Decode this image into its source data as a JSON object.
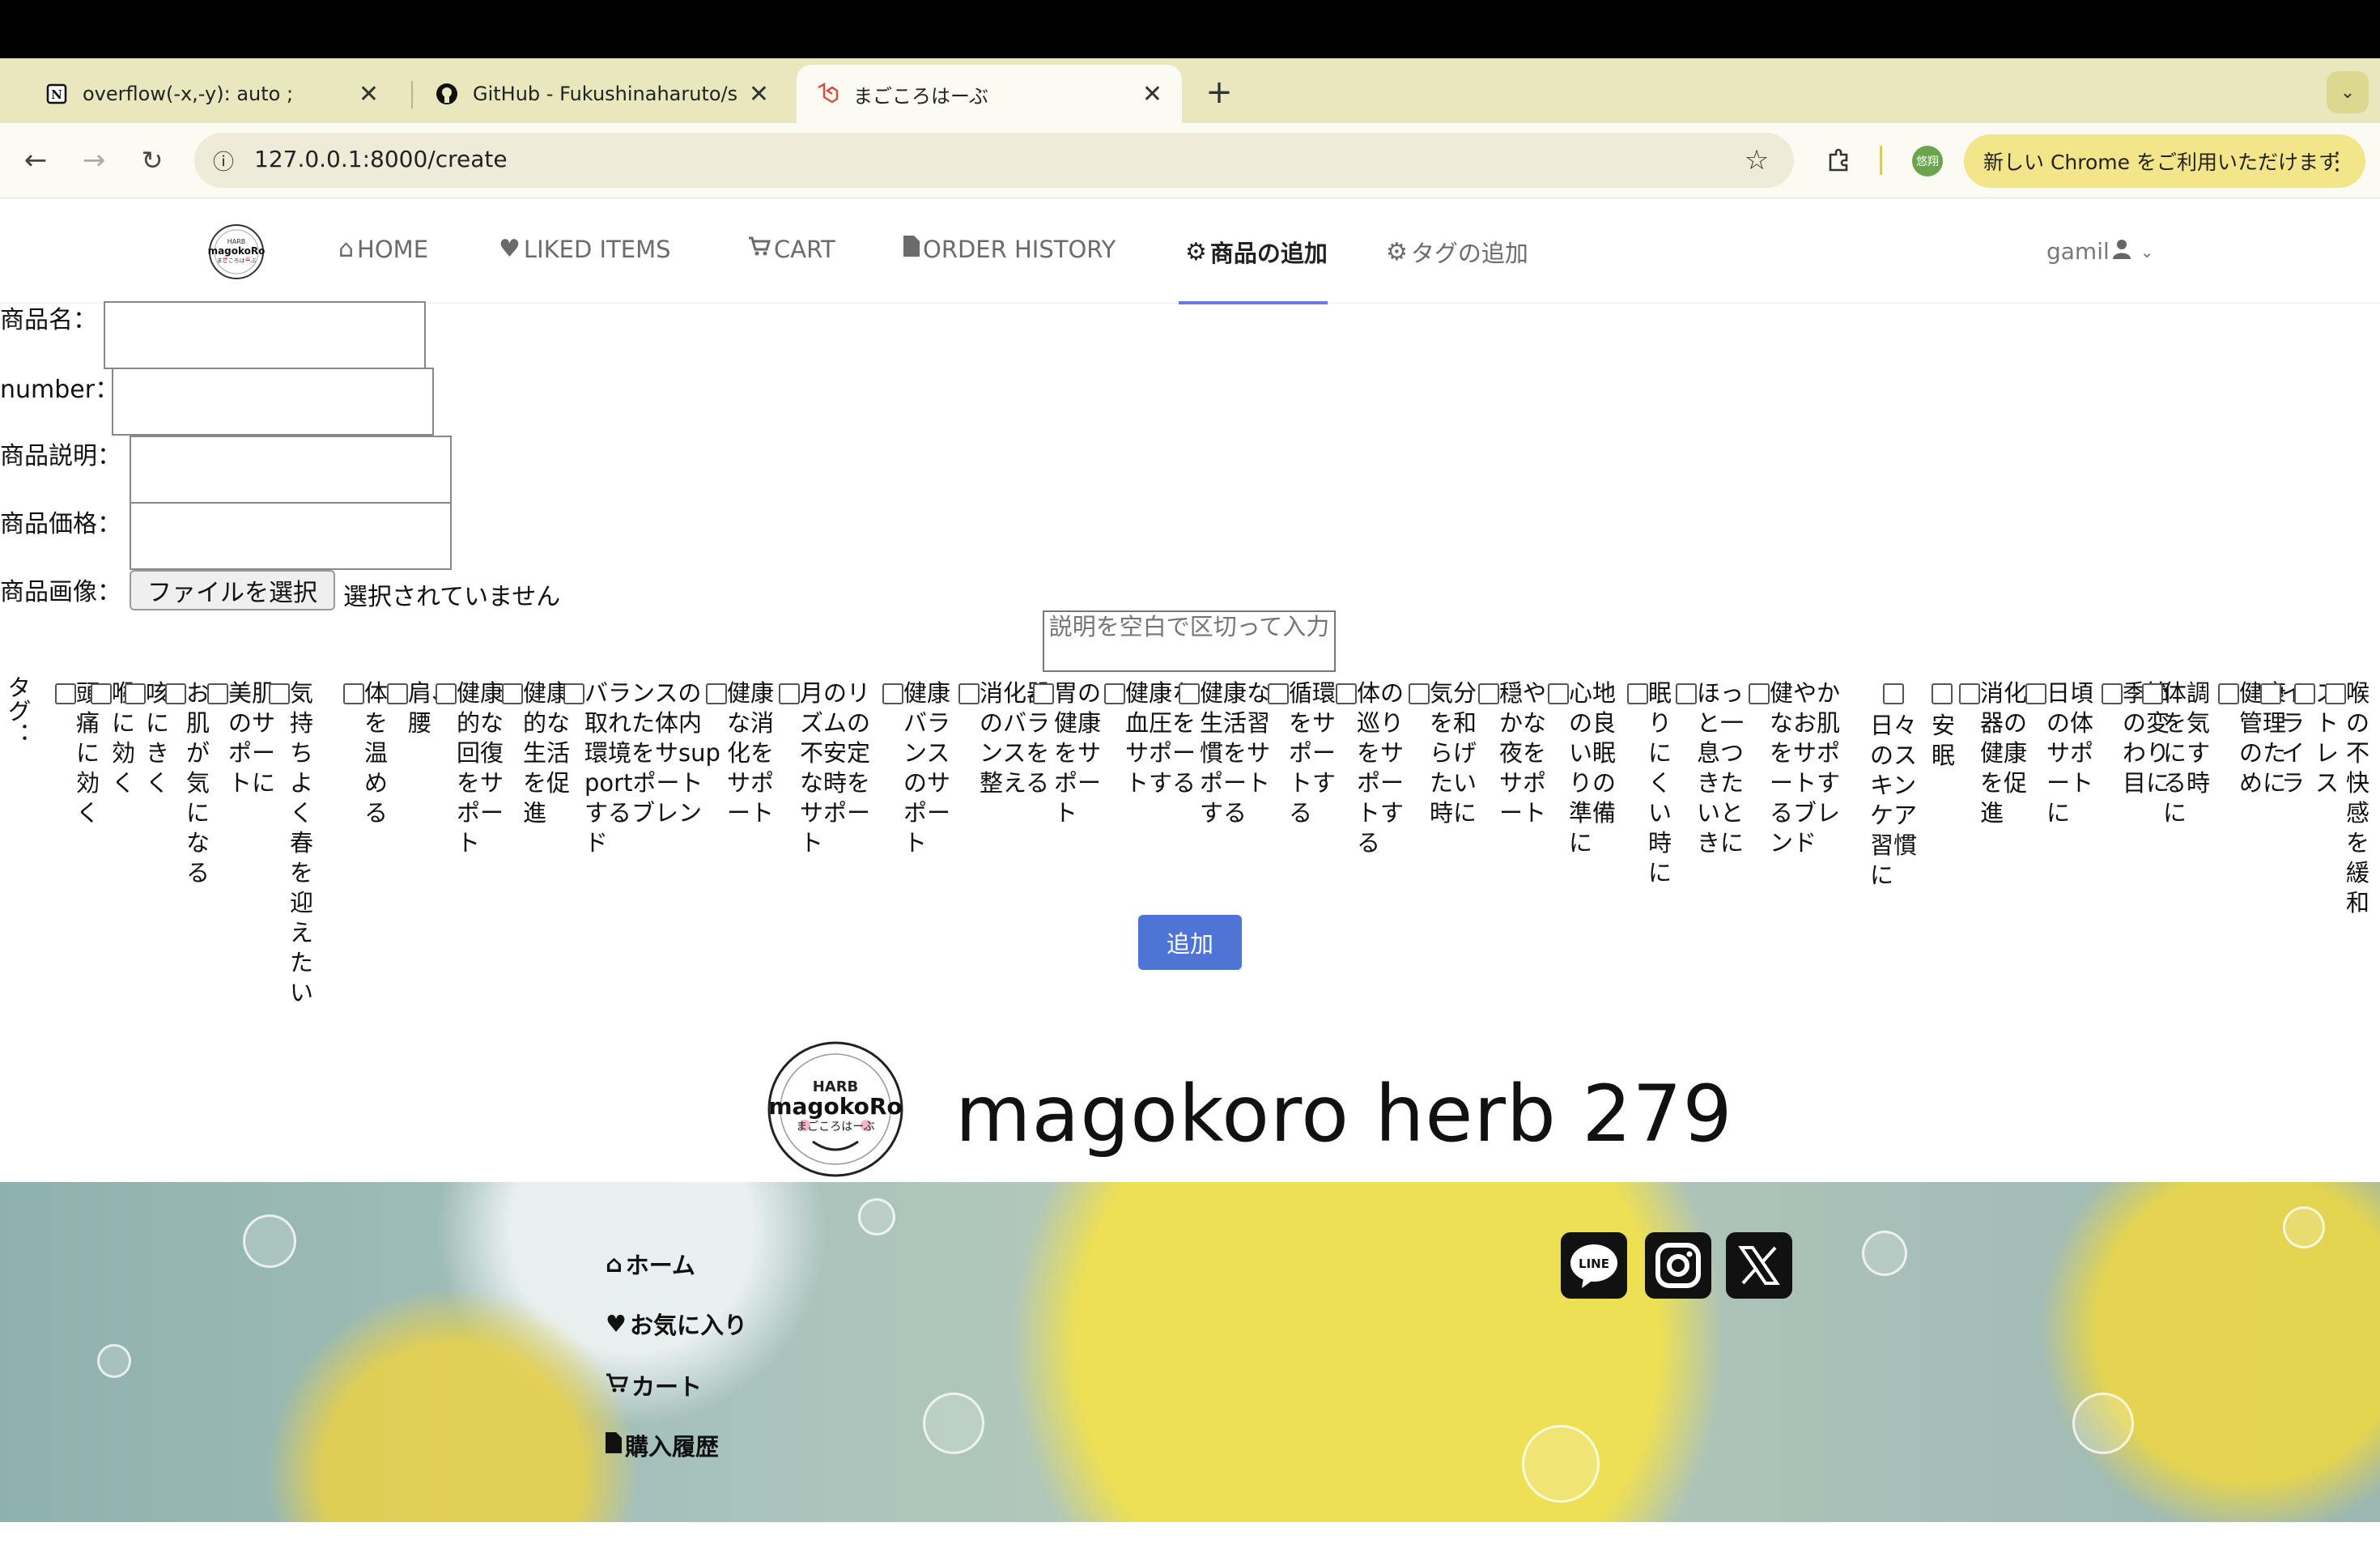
{
  "browser": {
    "tabs": [
      {
        "title": "overflow(-x,-y): auto ;",
        "icon": "notion-icon"
      },
      {
        "title": "GitHub - Fukushinaharuto/sho",
        "icon": "github-icon"
      },
      {
        "title": "まごころはーぶ",
        "icon": "laravel-icon",
        "active": true
      }
    ],
    "url": "127.0.0.1:8000/create",
    "profile_initials": "悠翔",
    "new_chrome_prompt": "新しい Chrome をご利用いただけます"
  },
  "nav": {
    "items": [
      {
        "label": "HOME",
        "icon": "home-icon"
      },
      {
        "label": "LIKED ITEMS",
        "icon": "heart-icon"
      },
      {
        "label": "CART",
        "icon": "cart-icon"
      },
      {
        "label": "ORDER HISTORY",
        "icon": "file-icon"
      },
      {
        "label": "商品の追加",
        "icon": "gear-icon",
        "active": true
      },
      {
        "label": "タグの追加",
        "icon": "gear-icon"
      }
    ],
    "user": "gamil"
  },
  "form": {
    "name_label": "商品名：",
    "number_label": "number：",
    "description_label": "商品説明：",
    "price_label": "商品価格：",
    "image_label": "商品画像：",
    "file_button": "ファイルを選択",
    "file_status": "選択されていません",
    "tag_desc_placeholder": "説明を空白で区切って入力",
    "tag_label": "タグ：",
    "submit_label": "追加"
  },
  "tags": [
    "頭痛に効く",
    "喉に効く",
    "咳にきく",
    "お肌が気になる",
    "美肌のサポートに",
    "気持ちよく春を迎えたい",
    "体を温める",
    "肩、腰",
    "健康的な回復をサポート",
    "健康的な生活を促進",
    "バランスの取れた体内環境をサsupportポートするブレンド",
    "健康な消化をサポート",
    "月のリズムの不安定な時をサポート",
    "健康バランスのサポート",
    "消化器のバランスを整える",
    "胃の健康をサポート",
    "健康な血圧をサポートする",
    "健康な生活習慣をサポートする",
    "循環をサポートする",
    "体の巡りをサポートする",
    "気分を和らげたい時に",
    "穏やかな夜をサポート",
    "心地の良い眠りの準備に",
    "眠りにくい時に",
    "ほっと一息つきたいときに",
    "健やかなお肌をサポートするブレンド",
    "日々のスキンケア習慣に",
    "安眠",
    "消化器の健康を促進",
    "日頃の体サポートに",
    "季節の変わり目に",
    "体調を気にする時に",
    "健康管理のために",
    "イライラ",
    "ストレス",
    "喉の不快感を緩和"
  ],
  "footer": {
    "brand": "magokoro herb 279",
    "logo_top": "HARB",
    "logo_main": "magokoRo",
    "logo_sub": "まごころはーぶ",
    "links": [
      {
        "label": "ホーム",
        "icon": "home-icon"
      },
      {
        "label": "お気に入り",
        "icon": "heart-icon"
      },
      {
        "label": "カート",
        "icon": "cart-icon"
      },
      {
        "label": "購入履歴",
        "icon": "file-icon"
      }
    ],
    "social": [
      {
        "name": "line-icon",
        "text": "LINE"
      },
      {
        "name": "instagram-icon"
      },
      {
        "name": "x-icon"
      }
    ]
  }
}
